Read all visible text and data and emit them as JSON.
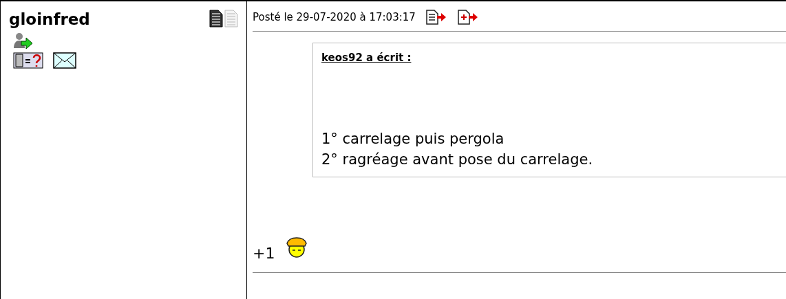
{
  "author": {
    "name": "gloinfred"
  },
  "post": {
    "date": "Posté le 29-07-2020 à 17:03:17",
    "quote": {
      "title": "keos92 a écrit :",
      "lines": [
        "1° carrelage puis pergola",
        "2° ragréage avant pose du carrelage."
      ]
    },
    "body": "+1"
  }
}
